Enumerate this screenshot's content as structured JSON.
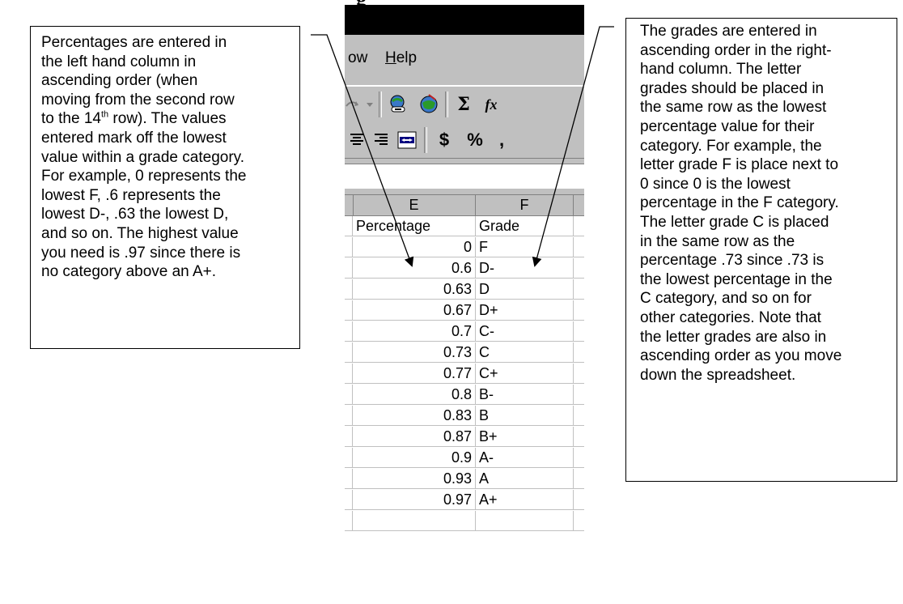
{
  "heading_fragment": "g",
  "callouts": {
    "left": {
      "lines": [
        "Percentages are entered in",
        "the left hand column in",
        "ascending order (when",
        "moving from the second row",
        "__ROW14__",
        "entered mark off the lowest",
        "value within a grade category.",
        "For example, 0 represents the",
        "lowest F, .6 represents the",
        "lowest D-, .63 the lowest D,",
        "and so on.  The highest value",
        "you need is .97 since there is",
        "no category above an A+."
      ],
      "row14_prefix": "to the 14",
      "row14_sup": "th",
      "row14_suffix": " row).  The values"
    },
    "right": {
      "lines": [
        "The grades are entered in",
        "ascending order in the right-",
        "hand column.  The letter",
        "grades should be placed in",
        "the same row as the lowest",
        "percentage value for their",
        "category.  For example, the",
        "letter grade F is place next to",
        "0 since 0 is the lowest",
        "percentage in the F category.",
        "The letter grade C is placed",
        "in the same row as the",
        "percentage .73 since .73 is",
        "the lowest percentage in the",
        "C category, and so on for",
        "other categories.  Note that",
        "the letter grades are also in",
        "ascending order as you move",
        "down the spreadsheet."
      ]
    }
  },
  "menu": {
    "window_partial": "ow",
    "help_u": "H",
    "help_rest": "elp"
  },
  "toolbar": {
    "sum_symbol": "Σ",
    "fx_symbol": "fx",
    "currency": "$",
    "percent": "%",
    "comma": ","
  },
  "columns": {
    "e": "E",
    "f": "F"
  },
  "header_row": {
    "e": "Percentage",
    "f": "Grade"
  },
  "rows": [
    {
      "pct": "0",
      "grade": "F"
    },
    {
      "pct": "0.6",
      "grade": "D-"
    },
    {
      "pct": "0.63",
      "grade": "D"
    },
    {
      "pct": "0.67",
      "grade": "D+"
    },
    {
      "pct": "0.7",
      "grade": "C-"
    },
    {
      "pct": "0.73",
      "grade": "C"
    },
    {
      "pct": "0.77",
      "grade": "C+"
    },
    {
      "pct": "0.8",
      "grade": "B-"
    },
    {
      "pct": "0.83",
      "grade": "B"
    },
    {
      "pct": "0.87",
      "grade": "B+"
    },
    {
      "pct": "0.9",
      "grade": "A-"
    },
    {
      "pct": "0.93",
      "grade": "A"
    },
    {
      "pct": "0.97",
      "grade": "A+"
    }
  ]
}
